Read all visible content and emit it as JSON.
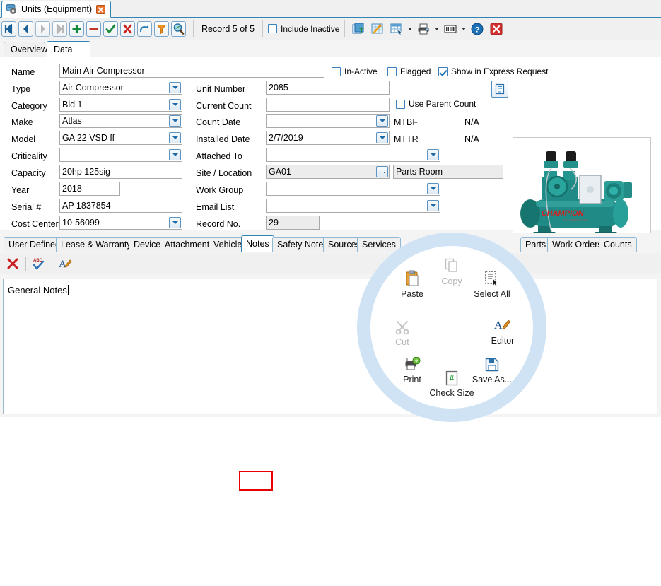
{
  "window": {
    "tab_title": "Units (Equipment)",
    "tab_icon": "database-gear-icon",
    "close_icon": "close-icon"
  },
  "navbar": {
    "buttons": [
      {
        "name": "first-record-button",
        "icon": "first-record-icon"
      },
      {
        "name": "previous-record-button",
        "icon": "previous-record-icon"
      },
      {
        "name": "next-record-button",
        "icon": "next-record-icon"
      },
      {
        "name": "last-record-button",
        "icon": "last-record-icon"
      },
      {
        "name": "add-record-button",
        "icon": "plus-icon"
      },
      {
        "name": "delete-record-button",
        "icon": "minus-icon"
      },
      {
        "name": "save-record-button",
        "icon": "check-icon"
      },
      {
        "name": "cancel-record-button",
        "icon": "x-icon"
      },
      {
        "name": "refresh-button",
        "icon": "redo-arrow-icon"
      },
      {
        "name": "filter-button",
        "icon": "funnel-icon"
      },
      {
        "name": "find-button",
        "icon": "magnifier-icon"
      }
    ],
    "record_label": "Record 5 of 5",
    "include_inactive_label": "Include Inactive",
    "include_inactive_checked": false,
    "right_icons": [
      {
        "name": "export-grid-button",
        "icon": "export-grid-icon"
      },
      {
        "name": "grid-tools-button",
        "icon": "grid-wrench-icon"
      },
      {
        "name": "select-columns-button",
        "icon": "grid-select-icon",
        "has_caret": true
      },
      {
        "name": "print-button",
        "icon": "printer-icon",
        "has_caret": true
      },
      {
        "name": "barcode-button",
        "icon": "barcode-icon",
        "has_caret": true
      },
      {
        "name": "help-button",
        "icon": "help-question-icon"
      },
      {
        "name": "close-window-button",
        "icon": "close-red-icon"
      }
    ]
  },
  "view_tabs": [
    {
      "label": "Overview",
      "active": false
    },
    {
      "label": "Data View",
      "active": true
    }
  ],
  "form": {
    "left_fields": [
      {
        "label": "Name",
        "value": "Main Air Compressor",
        "type": "text",
        "wide": true
      },
      {
        "label": "Type",
        "value": "Air Compressor",
        "type": "combo"
      },
      {
        "label": "Category",
        "value": "Bld 1",
        "type": "combo"
      },
      {
        "label": "Make",
        "value": "Atlas",
        "type": "combo"
      },
      {
        "label": "Model",
        "value": "GA 22 VSD ff",
        "type": "combo"
      },
      {
        "label": "Criticality",
        "value": "",
        "type": "combo"
      },
      {
        "label": "Capacity",
        "value": "20hp 125sig",
        "type": "text"
      },
      {
        "label": "Year",
        "value": "2018",
        "type": "text",
        "short": true
      },
      {
        "label": "Serial #",
        "value": "AP 1837854",
        "type": "text"
      },
      {
        "label": "Cost Center",
        "value": "10-56099",
        "type": "combo"
      }
    ],
    "mid_fields": [
      {
        "label": "Unit Number",
        "value": "2085",
        "type": "text"
      },
      {
        "label": "Current Count",
        "value": "",
        "type": "text"
      },
      {
        "label": "Count Date",
        "value": "",
        "type": "combo"
      },
      {
        "label": "Installed Date",
        "value": "2/7/2019",
        "type": "combo"
      },
      {
        "label": "Attached To",
        "value": "",
        "type": "combo-wide"
      },
      {
        "label": "Site / Location",
        "value": "GA01",
        "type": "ellipsis",
        "readonly": true
      },
      {
        "label": "Work Group",
        "value": "",
        "type": "combo-wide"
      },
      {
        "label": "Email List",
        "value": "",
        "type": "combo-wide"
      },
      {
        "label": "Record No.",
        "value": "29",
        "type": "text",
        "readonly": true,
        "short": true
      }
    ],
    "location_name": "Parts Room",
    "checkboxes": [
      {
        "label": "In-Active",
        "checked": false
      },
      {
        "label": "Flagged",
        "checked": false
      },
      {
        "label": "Show in Express Request",
        "checked": true
      },
      {
        "label": "Use Parent Count",
        "checked": false
      }
    ],
    "stats": [
      {
        "label": "MTBF",
        "value": "N/A"
      },
      {
        "label": "MTTR",
        "value": "N/A"
      }
    ],
    "notes_doc_button": "notes-document-icon",
    "equipment_image_alt": "air-compressor-photo",
    "equipment_image_brand": "CHAMPION"
  },
  "bottom_tabs": [
    {
      "label": "User Defined",
      "active": false
    },
    {
      "label": "Lease & Warranty",
      "active": false
    },
    {
      "label": "Device",
      "active": false
    },
    {
      "label": "Attachments",
      "active": false
    },
    {
      "label": "Vehicle",
      "active": false
    },
    {
      "label": "Notes",
      "active": true,
      "highlighted": true
    },
    {
      "label": "Safety Notes",
      "active": false
    },
    {
      "label": "Sources",
      "active": false
    },
    {
      "label": "Services",
      "active": false
    },
    {
      "label": "Parts",
      "active": false
    },
    {
      "label": "Work Orders",
      "active": false
    },
    {
      "label": "Counts",
      "active": false
    }
  ],
  "notes_toolbar": [
    {
      "name": "clear-notes-button",
      "icon": "red-x-icon"
    },
    {
      "name": "spell-check-button",
      "icon": "abc-check-icon"
    },
    {
      "name": "format-text-button",
      "icon": "font-pencil-icon"
    }
  ],
  "notes": {
    "text": "General Notes"
  },
  "radial_menu": {
    "center_icon": "gear-wheel-icon",
    "items": [
      {
        "label": "Copy",
        "icon": "copy-icon",
        "disabled": true
      },
      {
        "label": "Paste",
        "icon": "paste-icon",
        "disabled": false
      },
      {
        "label": "Select All",
        "icon": "select-all-icon",
        "disabled": false
      },
      {
        "label": "Cut",
        "icon": "scissors-icon",
        "disabled": true
      },
      {
        "label": "Editor",
        "icon": "editor-pencil-icon",
        "disabled": false
      },
      {
        "label": "Print",
        "icon": "printer-preview-icon",
        "disabled": false
      },
      {
        "label": "Check Size",
        "icon": "check-size-icon",
        "disabled": false
      },
      {
        "label": "Save As...",
        "icon": "save-as-icon",
        "disabled": false
      }
    ]
  },
  "colors": {
    "accent": "#2f83b5",
    "ring": "#cfe3f5",
    "highlight": "#e60000",
    "equipment_teal": "#1f8a86"
  }
}
